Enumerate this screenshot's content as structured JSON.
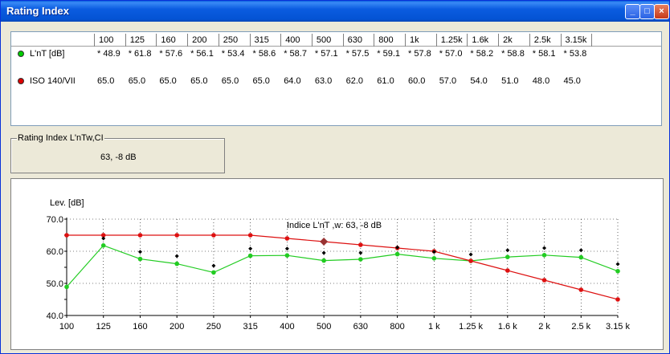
{
  "window": {
    "title": "Rating Index",
    "buttons": {
      "minimize": "_",
      "maximize": "□",
      "close": "×"
    }
  },
  "table": {
    "frequencies": [
      "100",
      "125",
      "160",
      "200",
      "250",
      "315",
      "400",
      "500",
      "630",
      "800",
      "1k",
      "1.25k",
      "1.6k",
      "2k",
      "2.5k",
      "3.15k"
    ],
    "rows": [
      {
        "label": "L'nT [dB]",
        "color": "#00cc00",
        "values": [
          "* 48.9",
          "* 61.8",
          "* 57.6",
          "* 56.1",
          "* 53.4",
          "* 58.6",
          "* 58.7",
          "* 57.1",
          "* 57.5",
          "* 59.1",
          "* 57.8",
          "* 57.0",
          "* 58.2",
          "* 58.8",
          "* 58.1",
          "* 53.8"
        ]
      },
      {
        "label": "ISO 140/VII",
        "color": "#dd0000",
        "values": [
          "65.0",
          "65.0",
          "65.0",
          "65.0",
          "65.0",
          "65.0",
          "64.0",
          "63.0",
          "62.0",
          "61.0",
          "60.0",
          "57.0",
          "54.0",
          "51.0",
          "48.0",
          "45.0"
        ]
      }
    ]
  },
  "rating": {
    "legend": "Rating Index L'nTw,CI",
    "value": "63, -8   dB"
  },
  "chart_data": {
    "type": "line",
    "ylabel": "Lev. [dB]",
    "annotation": "Indice L'nT ,w: 63, -8   dB",
    "categories": [
      "100",
      "125",
      "160",
      "200",
      "250",
      "315",
      "400",
      "500",
      "630",
      "800",
      "1 k",
      "1.25 k",
      "1.6 k",
      "2 k",
      "2.5 k",
      "3.15 k"
    ],
    "ylim": [
      40,
      70
    ],
    "yticks": [
      "40.0",
      "50.0",
      "60.0",
      "70.0"
    ],
    "grid": true,
    "series": [
      {
        "color": "#22cc22",
        "values": [
          48.9,
          61.8,
          57.6,
          56.1,
          53.4,
          58.6,
          58.7,
          57.1,
          57.5,
          59.1,
          57.8,
          57.0,
          58.2,
          58.8,
          58.1,
          53.8
        ]
      },
      {
        "color": "#dd1111",
        "values": [
          65.0,
          65.0,
          65.0,
          65.0,
          65.0,
          65.0,
          64.0,
          63.0,
          62.0,
          61.0,
          60.0,
          57.0,
          54.0,
          51.0,
          48.0,
          45.0
        ]
      },
      {
        "color": "#000000",
        "marker": "diamond",
        "values": [
          null,
          64.0,
          59.8,
          58.5,
          55.5,
          60.8,
          60.8,
          59.5,
          59.5,
          61.2,
          59.8,
          59.0,
          60.3,
          61.0,
          60.3,
          56.0
        ]
      }
    ],
    "highlight": {
      "category": "500",
      "value": 63.0,
      "color": "#993333"
    }
  }
}
